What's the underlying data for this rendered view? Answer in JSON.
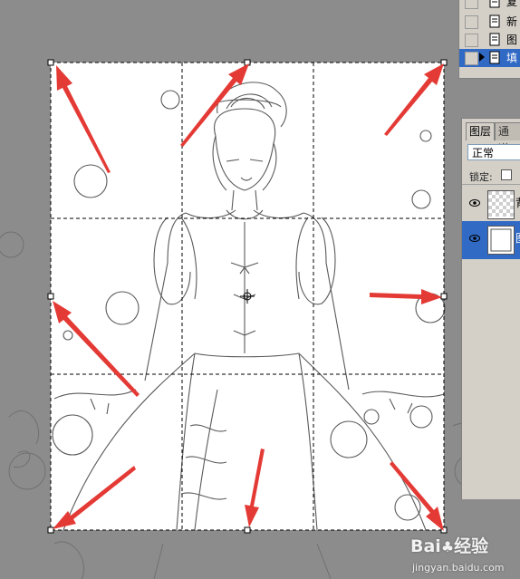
{
  "actions_panel": {
    "rows": [
      {
        "label": "复",
        "selected": false
      },
      {
        "label": "新",
        "selected": false
      },
      {
        "label": "图",
        "selected": false
      },
      {
        "label": "填",
        "selected": true
      }
    ]
  },
  "layers_panel": {
    "tabs": [
      "图层",
      "通道"
    ],
    "blend_mode": "正常",
    "lock_label": "锁定:",
    "layers": [
      {
        "name": "背",
        "selected": false,
        "thumb": "transparent"
      },
      {
        "name": "图",
        "selected": true,
        "thumb": "white"
      }
    ]
  },
  "watermark": {
    "logo_text": "Bai",
    "logo_text2": "经验",
    "url": "jingyan.baidu.com"
  },
  "colors": {
    "arrow": "#e43a35",
    "selection": "#316ac5",
    "panel": "#d4d0c8",
    "background": "#8c8c8c"
  }
}
